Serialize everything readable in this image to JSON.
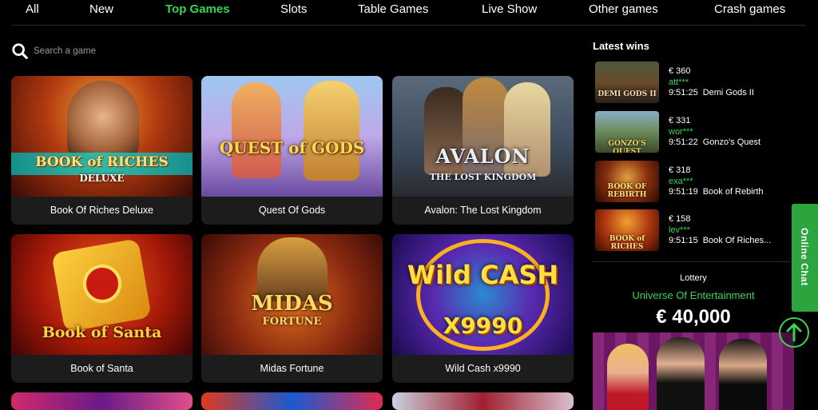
{
  "nav": {
    "tabs": [
      {
        "label": "All",
        "active": false
      },
      {
        "label": "New",
        "active": false
      },
      {
        "label": "Top Games",
        "active": true
      },
      {
        "label": "Slots",
        "active": false
      },
      {
        "label": "Table Games",
        "active": false
      },
      {
        "label": "Live Show",
        "active": false
      },
      {
        "label": "Other games",
        "active": false
      },
      {
        "label": "Crash games",
        "active": false
      }
    ]
  },
  "search": {
    "placeholder": "Search a game",
    "value": ""
  },
  "games": [
    {
      "name": "Book Of Riches Deluxe",
      "art_logo": "BOOK of RICHES",
      "art_sub": "DELUXE"
    },
    {
      "name": "Quest Of Gods",
      "art_logo": "QUEST of GODS",
      "art_sub": ""
    },
    {
      "name": "Avalon: The Lost Kingdom",
      "art_logo": "AVALON",
      "art_sub": "THE LOST KINGDOM"
    },
    {
      "name": "Book of Santa",
      "art_logo": "Book of Santa",
      "art_sub": ""
    },
    {
      "name": "Midas Fortune",
      "art_logo": "MIDAS",
      "art_sub": "FORTUNE"
    },
    {
      "name": "Wild Cash x9990",
      "art_logo": "Wild CASH",
      "art_sub": "X9990"
    }
  ],
  "latest_wins": {
    "title": "Latest wins",
    "items": [
      {
        "amount": "€ 360",
        "user": "att***",
        "time": "9:51:25",
        "game": "Demi Gods II",
        "art": "DEMI GODS II"
      },
      {
        "amount": "€ 331",
        "user": "wor***",
        "time": "9:51:22",
        "game": "Gonzo's Quest",
        "art": "GONZO'S QUEST"
      },
      {
        "amount": "€ 318",
        "user": "exa***",
        "time": "9:51:19",
        "game": "Book of Rebirth",
        "art": "BOOK OF REBIRTH"
      },
      {
        "amount": "€ 158",
        "user": "lev***",
        "time": "9:51:15",
        "game": "Book Of Riches...",
        "art": "BOOK of RICHES"
      }
    ]
  },
  "lottery": {
    "label": "Lottery",
    "name": "Universe Of Entertainment",
    "amount": "€ 40,000"
  },
  "online_chat": {
    "label": "Online Chat"
  },
  "colors": {
    "accent": "#39d353",
    "background": "#000000",
    "card": "#1c1c1c",
    "chat": "#2da53f"
  }
}
